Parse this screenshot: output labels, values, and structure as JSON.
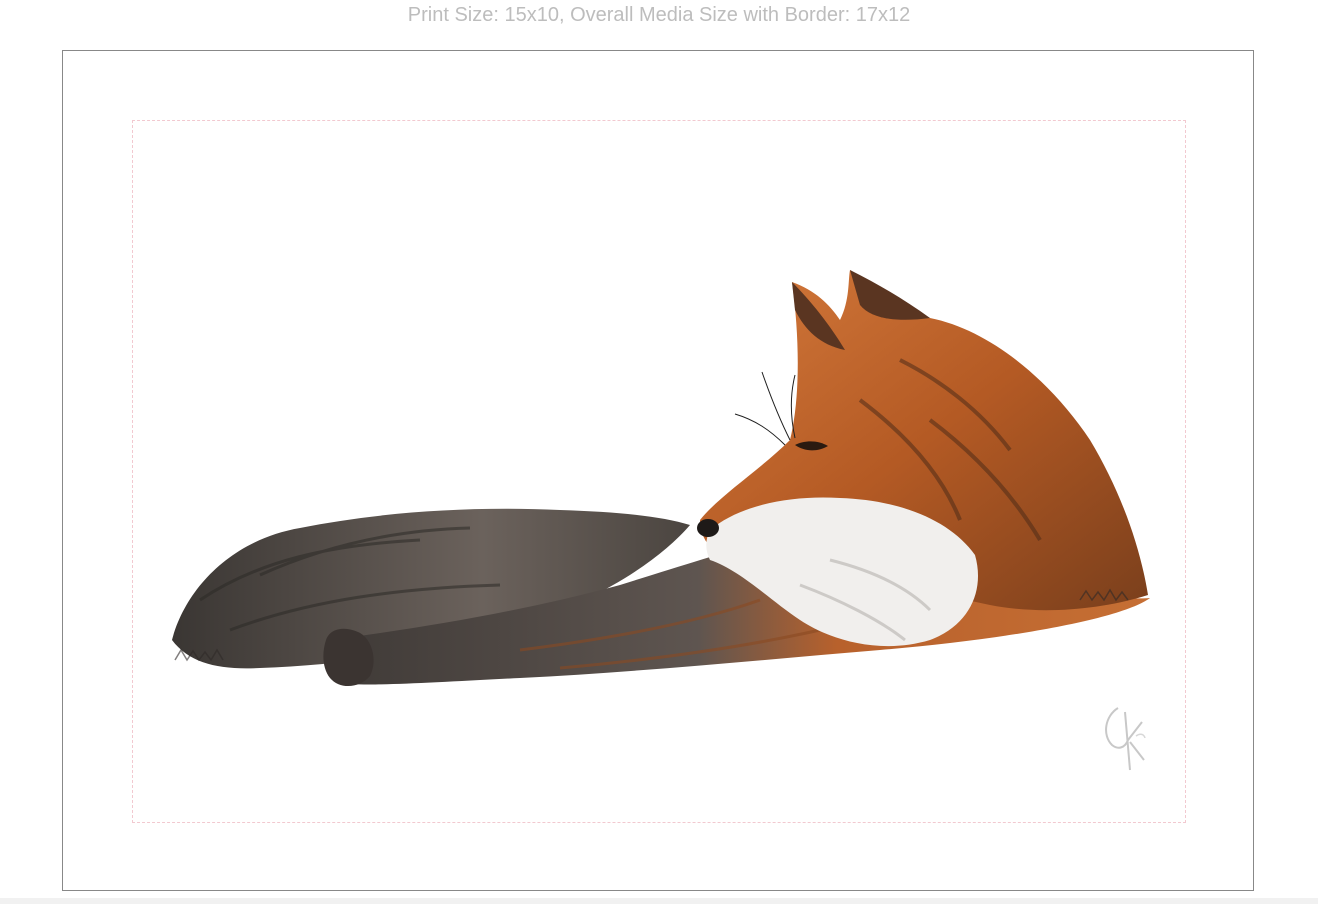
{
  "caption": "Print Size: 15x10, Overall Media Size with Border: 17x12",
  "artwork": {
    "subject_icon": "fox-painting",
    "signature_icon": "artist-signature",
    "colors": {
      "fur_orange": "#c8682e",
      "fur_dark": "#4a4440",
      "tail_grey": "#55504c",
      "chest_white": "#eeeeee",
      "frame_border": "#888888",
      "print_guide": "#f2c9d0",
      "caption_text": "#bdbdbd"
    }
  }
}
